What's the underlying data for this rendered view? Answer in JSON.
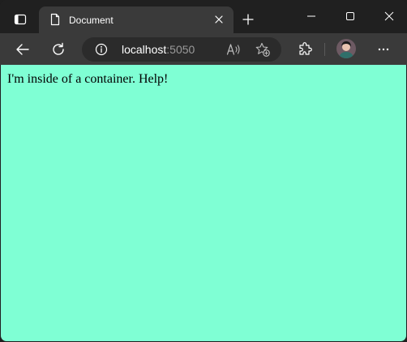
{
  "browser": {
    "tab": {
      "title": "Document"
    },
    "address_bar": {
      "host": "localhost",
      "port": ":5050"
    }
  },
  "page": {
    "background_color": "#7fffd4",
    "text": "I'm inside of a container. Help!"
  },
  "icons": [
    "tab-actions-icon",
    "page-icon",
    "close-icon",
    "plus-icon",
    "minimize-icon",
    "maximize-icon",
    "close-window-icon",
    "back-arrow-icon",
    "reload-icon",
    "info-icon",
    "read-aloud-icon",
    "favorite-add-icon",
    "extensions-icon",
    "profile-avatar",
    "more-icon"
  ]
}
